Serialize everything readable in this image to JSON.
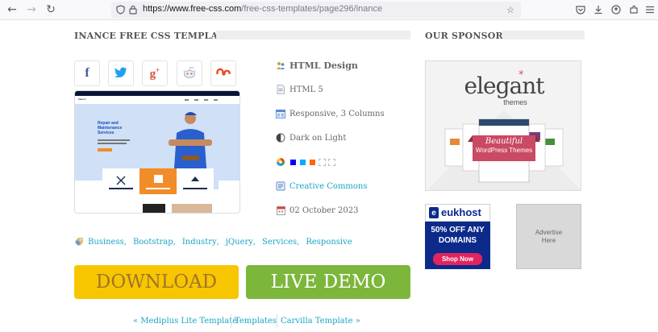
{
  "browser": {
    "url_host": "https://www.free-css.com",
    "url_path": "/free-css-templates/page296/inance"
  },
  "main": {
    "title": "INANCE FREE CSS TEMPLATE",
    "info": {
      "name": "HTML Design",
      "version": "HTML 5",
      "layout": "Responsive, 3 Columns",
      "theme": "Dark on Light",
      "swatches": [
        "#0000ff",
        "#00aaff",
        "#ff6600",
        "#ffffff",
        "#ffffff"
      ],
      "license": "Creative Commons",
      "date": "02 October 2023"
    },
    "tags": [
      "Business",
      "Bootstrap",
      "Industry",
      "jQuery",
      "Services",
      "Responsive"
    ],
    "download_label": "DOWNLOAD",
    "live_demo_label": "LIVE DEMO",
    "pager": {
      "prev": "« Mediplus Lite Template",
      "middle": "Templates",
      "next": "Carvilla Template »"
    },
    "preview": {
      "nav_logo": "Inance",
      "hero_title": "Repair and Maintenance Services"
    }
  },
  "sidebar": {
    "title": "OUR SPONSORS",
    "elegant": {
      "brand": "elegant",
      "brand_sub": "themes",
      "tagline": "Beautiful",
      "tagline2": "WordPress Themes"
    },
    "eukhost": {
      "brand": "eukhost",
      "offer": "50% OFF ANY",
      "domains": "DOMAINS",
      "cta": "Shop Now"
    },
    "advertise": "Advertise Here"
  },
  "colors": {
    "link": "#1aa5c4",
    "download_bg": "#f7c600",
    "live_demo_bg": "#7cb63b",
    "facebook": "#3b5998",
    "twitter": "#1da1f2",
    "googleplus": "#dd4b39",
    "stumbleupon": "#eb4924"
  }
}
